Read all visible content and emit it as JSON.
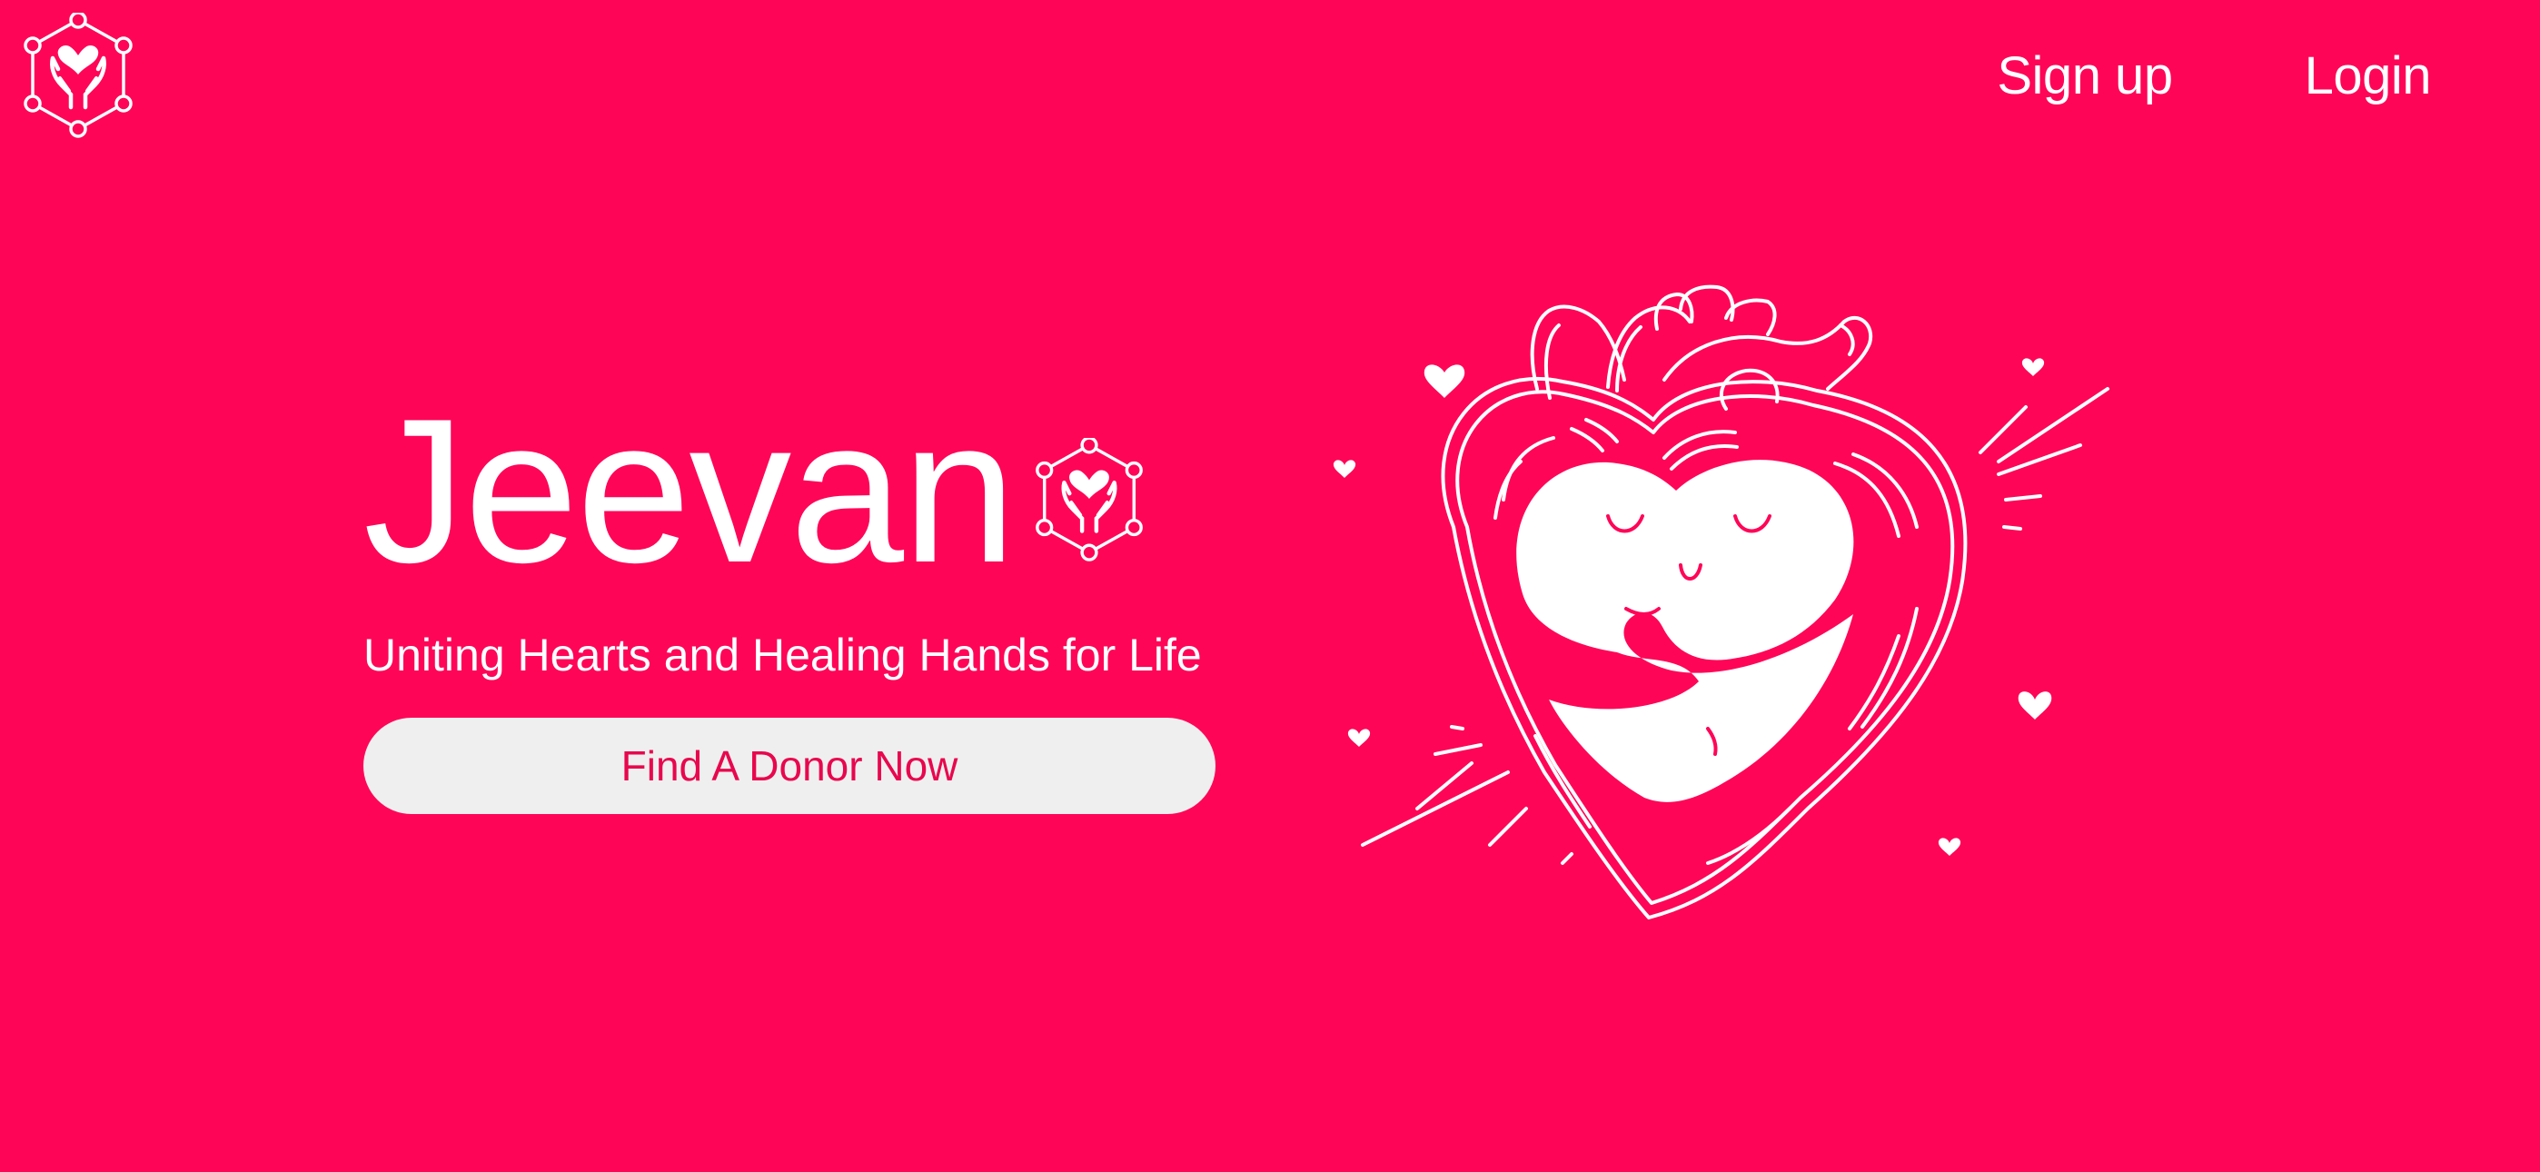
{
  "header": {
    "logo_icon": "hands-heart-network-icon",
    "nav": {
      "signup_label": "Sign up",
      "login_label": "Login"
    }
  },
  "hero": {
    "brand_name": "Jeevan",
    "brand_icon": "hands-heart-network-icon",
    "tagline": "Uniting Hearts and Healing Hands for Life",
    "cta_label": "Find A Donor Now"
  },
  "illustration": {
    "icon": "hugging-heart-illustration"
  },
  "colors": {
    "background": "#FF0558",
    "text": "#FFFFFF",
    "button_bg": "#EFEFEF",
    "button_text": "#E8074E"
  }
}
